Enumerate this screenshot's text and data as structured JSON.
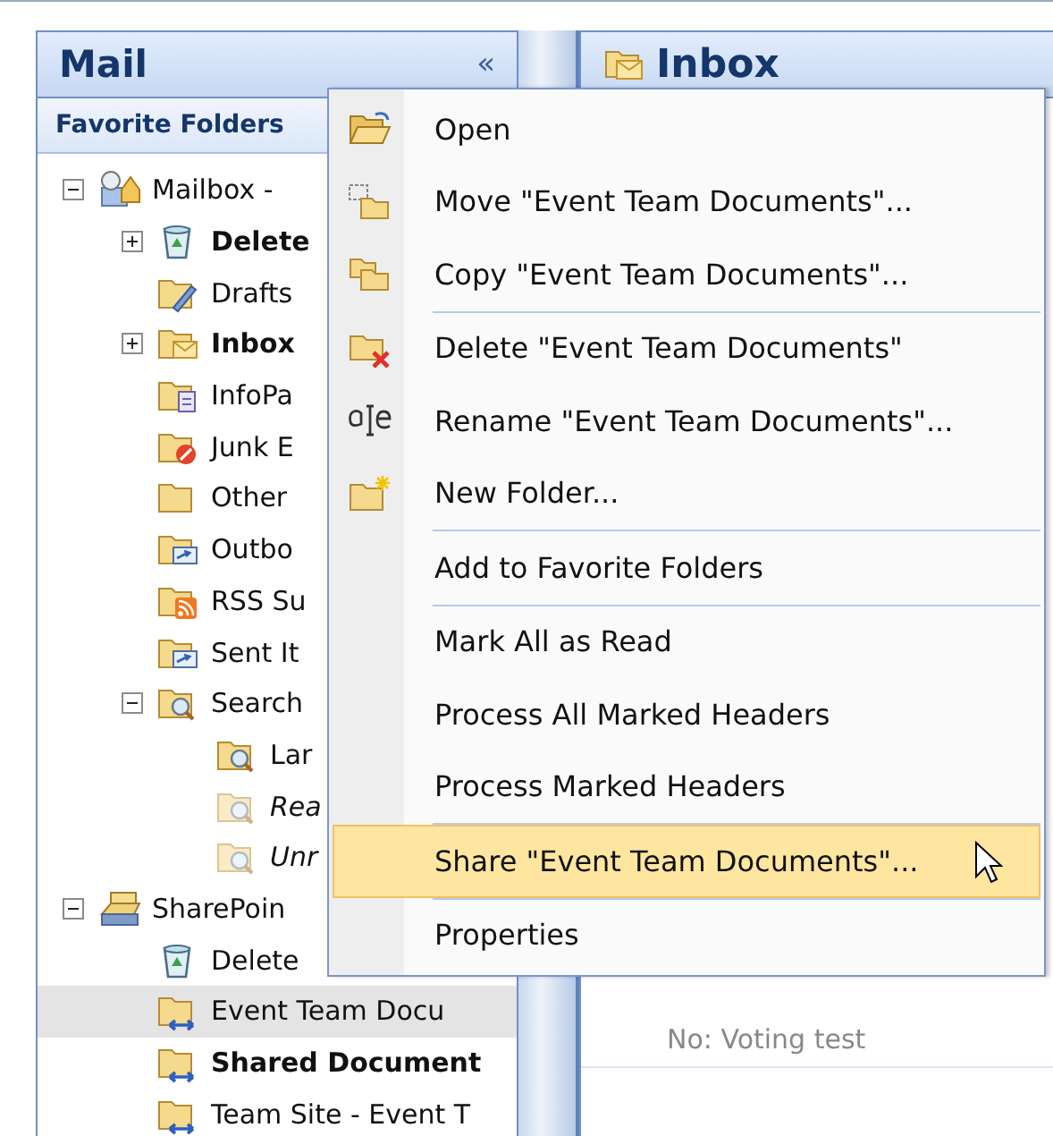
{
  "nav_pane": {
    "title": "Mail",
    "collapse_glyph": "«",
    "favorites_header": "Favorite Folders",
    "tree": [
      {
        "label": "Mailbox -",
        "kind": "mailbox",
        "bold": false,
        "italic": false,
        "selected": false,
        "expanded": true,
        "children": [
          {
            "label": "Delete",
            "kind": "trash",
            "bold": true,
            "italic": false,
            "selected": false,
            "expanded": false
          },
          {
            "label": "Drafts",
            "kind": "drafts",
            "bold": false,
            "italic": false,
            "selected": false
          },
          {
            "label": "Inbox",
            "kind": "inbox",
            "bold": true,
            "italic": false,
            "selected": false,
            "expanded": false
          },
          {
            "label": "InfoPa",
            "kind": "form",
            "bold": false,
            "italic": false,
            "selected": false
          },
          {
            "label": "Junk E",
            "kind": "junk",
            "bold": false,
            "italic": false,
            "selected": false
          },
          {
            "label": "Other",
            "kind": "folder",
            "bold": false,
            "italic": false,
            "selected": false
          },
          {
            "label": "Outbo",
            "kind": "outbox",
            "bold": false,
            "italic": false,
            "selected": false
          },
          {
            "label": "RSS Su",
            "kind": "rss",
            "bold": false,
            "italic": false,
            "selected": false
          },
          {
            "label": "Sent It",
            "kind": "sent",
            "bold": false,
            "italic": false,
            "selected": false
          },
          {
            "label": "Search",
            "kind": "search",
            "bold": false,
            "italic": false,
            "selected": false,
            "expanded": true,
            "children": [
              {
                "label": "Lar",
                "kind": "search",
                "bold": false,
                "italic": false,
                "selected": false
              },
              {
                "label": "Rea",
                "kind": "search-faded",
                "bold": false,
                "italic": true,
                "selected": false
              },
              {
                "label": "Unr",
                "kind": "search-faded",
                "bold": false,
                "italic": true,
                "selected": false
              }
            ]
          }
        ]
      },
      {
        "label": "SharePoin",
        "kind": "sharepoint",
        "bold": false,
        "italic": false,
        "selected": false,
        "expanded": true,
        "children": [
          {
            "label": "Delete",
            "kind": "trash",
            "bold": false,
            "italic": false,
            "selected": false
          },
          {
            "label": "Event Team Docu",
            "kind": "linked",
            "bold": false,
            "italic": false,
            "selected": true
          },
          {
            "label": "Shared Document",
            "kind": "linked",
            "bold": true,
            "italic": false,
            "selected": false
          },
          {
            "label": "Team Site - Event T",
            "kind": "linked",
            "bold": false,
            "italic": false,
            "selected": false
          }
        ]
      }
    ]
  },
  "content_pane": {
    "title": "Inbox",
    "preview_line": "No: Voting test"
  },
  "context_menu": {
    "groups": [
      [
        {
          "label": "Open",
          "selected": false
        },
        {
          "label": "Move \"Event Team Documents\"...",
          "selected": false
        },
        {
          "label": "Copy \"Event Team Documents\"...",
          "selected": false
        }
      ],
      [
        {
          "label": "Delete \"Event Team Documents\"",
          "selected": false
        },
        {
          "label": "Rename \"Event Team Documents\"...",
          "selected": false
        },
        {
          "label": "New Folder...",
          "selected": false
        }
      ],
      [
        {
          "label": "Add to Favorite Folders",
          "selected": false
        }
      ],
      [
        {
          "label": "Mark All as Read",
          "selected": false
        },
        {
          "label": "Process All Marked Headers",
          "selected": false
        },
        {
          "label": "Process Marked Headers",
          "selected": false
        }
      ],
      [
        {
          "label": "Share \"Event Team Documents\"...",
          "selected": true
        }
      ],
      [
        {
          "label": "Properties",
          "selected": false
        }
      ]
    ]
  }
}
